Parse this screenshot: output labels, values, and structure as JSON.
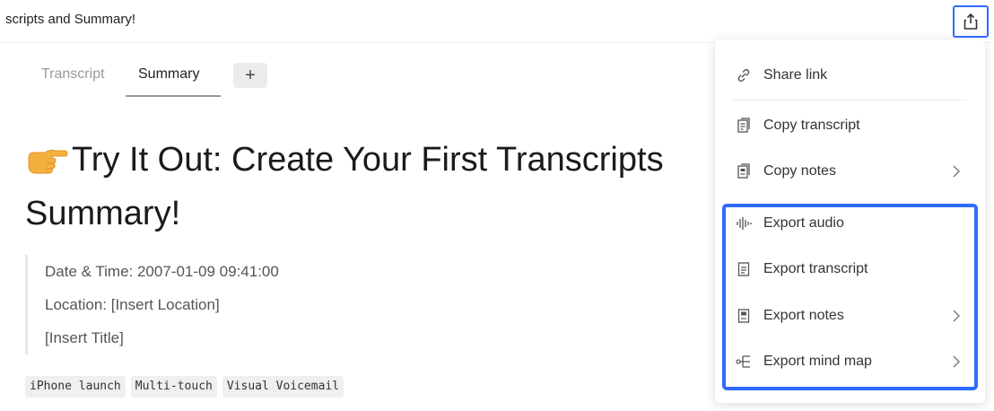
{
  "header": {
    "doc_title": "scripts and Summary!",
    "share_icon": "share-upload-icon",
    "accent_color": "#2f6bff"
  },
  "tabs": [
    {
      "label": "Transcript",
      "active": false
    },
    {
      "label": "Summary",
      "active": true
    }
  ],
  "add_tab_label": "+",
  "content": {
    "heading_emoji": "pointing-hand-icon",
    "heading": "Try It Out: Create Your First Transcripts Summary!",
    "quote_lines": [
      "Date & Time: 2007-01-09 09:41:00",
      "Location: [Insert Location]",
      "[Insert Title]"
    ],
    "tags": [
      "iPhone launch",
      "Multi-touch",
      "Visual Voicemail"
    ]
  },
  "share_menu": {
    "items": [
      {
        "label": "Share link",
        "icon": "link-icon",
        "has_submenu": false
      },
      {
        "label": "Copy transcript",
        "icon": "copy-transcript-icon",
        "has_submenu": false
      },
      {
        "label": "Copy notes",
        "icon": "copy-notes-icon",
        "has_submenu": true
      },
      {
        "label": "Export audio",
        "icon": "audio-waveform-icon",
        "has_submenu": false
      },
      {
        "label": "Export transcript",
        "icon": "transcript-file-icon",
        "has_submenu": false
      },
      {
        "label": "Export notes",
        "icon": "notes-file-icon",
        "has_submenu": true
      },
      {
        "label": "Export mind map",
        "icon": "mind-map-icon",
        "has_submenu": true
      }
    ],
    "highlight_color": "#2f6bff"
  }
}
